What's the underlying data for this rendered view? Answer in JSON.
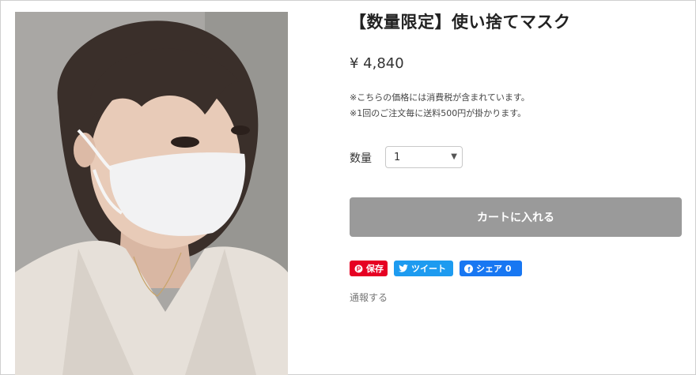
{
  "product": {
    "title": "【数量限定】使い捨てマスク",
    "price": "¥ 4,840",
    "notes": [
      "※こちらの価格には消費税が含まれています。",
      "※1回のご注文毎に送料500円が掛かります。"
    ],
    "quantity": {
      "label": "数量",
      "selected": "1"
    },
    "cart_button": "カートに入れる",
    "share": {
      "pinterest": "保存",
      "twitter": "ツイート",
      "facebook": "シェア 0"
    },
    "report_link": "通報する"
  },
  "colors": {
    "cart_button": "#9a9a9a",
    "pinterest": "#e60023",
    "twitter": "#1d9bf0",
    "facebook": "#1877f2"
  },
  "icons": [
    "pinterest-icon",
    "twitter-bird-icon",
    "facebook-icon",
    "chevron-down-icon"
  ]
}
